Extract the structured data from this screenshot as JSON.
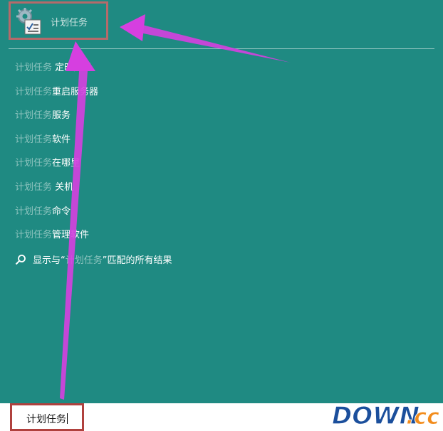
{
  "top_result": {
    "label": "计划任务",
    "icon": "task-scheduler-icon"
  },
  "suggestions": [
    {
      "query": "计划任务",
      "suffix": " 定时关机"
    },
    {
      "query": "计划任务",
      "suffix": "重启服务器"
    },
    {
      "query": "计划任务",
      "suffix": "服务"
    },
    {
      "query": "计划任务",
      "suffix": "软件"
    },
    {
      "query": "计划任务",
      "suffix": "在哪里"
    },
    {
      "query": "计划任务",
      "suffix": " 关机"
    },
    {
      "query": "计划任务",
      "suffix": "命令"
    },
    {
      "query": "计划任务",
      "suffix": "管理软件"
    }
  ],
  "show_all": {
    "icon": "search-icon",
    "prefix": "显示与“",
    "query": "计划任务",
    "postfix": "”匹配的所有结果"
  },
  "search_box": {
    "value": "计划任务"
  },
  "watermark": {
    "text_main": "DOWN",
    "text_suffix": ".cc"
  },
  "colors": {
    "background": "#1f8a82",
    "highlight_box": "#b56a6a",
    "search_highlight": "#b0413e",
    "annotation_arrow": "#d63fe0"
  }
}
